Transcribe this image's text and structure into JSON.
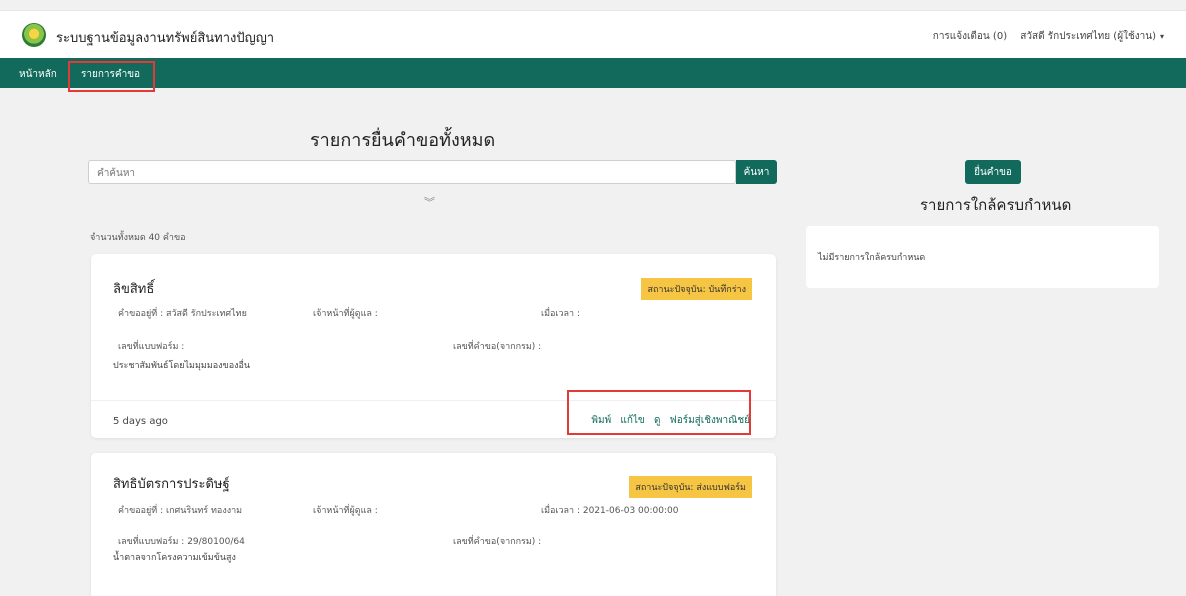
{
  "header": {
    "title": "ระบบฐานข้อมูลงานทรัพย์สินทางปัญญา",
    "notifications": "การแจ้งเตือน (0)",
    "user": "สวัสดี รักประเทศไทย (ผู้ใช้งาน)"
  },
  "nav": {
    "items": [
      "หน้าหลัก",
      "รายการคำขอ"
    ]
  },
  "main": {
    "title": "รายการยื่นคำขอทั้งหมด",
    "search_placeholder": "คำค้นหา",
    "search_button": "ค้นหา",
    "count": "จำนวนทั้งหมด 40 คำขอ"
  },
  "cards": [
    {
      "title": "ลิขสิทธิ์",
      "status": "สถานะปัจจุบัน: บันทึกร่าง",
      "requester": "คำขออยู่ที่ : สวัสดี รักประเทศไทย",
      "officer": "เจ้าหน้าที่ผู้ดูแล :",
      "time": "เมื่อเวลา :",
      "form_no": "เลขที่แบบฟอร์ม :",
      "request_no": "เลขที่คำขอ(จากกรม) :",
      "description": "ประชาสัมพันธ์โดยไมมุมมองของอื่น",
      "ago": "5 days ago",
      "actions": [
        "พิมพ์",
        "แก้ไข",
        "ดู",
        "ฟอร์มสู่เชิงพาณิชย์"
      ]
    },
    {
      "title": "สิทธิบัตรการประดิษฐ์",
      "status": "สถานะปัจจุบัน: ส่งแบบฟอร์ม",
      "requester": "คำขออยู่ที่ : เกศนรินทร์ ทองงาม",
      "officer": "เจ้าหน้าที่ผู้ดูแล :",
      "time": "เมื่อเวลา : 2021-06-03 00:00:00",
      "form_no": "เลขที่แบบฟอร์ม : 29/80100/64",
      "request_no": "เลขที่คำขอ(จากกรม) :",
      "description": "น้ำตาลจากโครงความเข้มข้นสูง"
    }
  ],
  "sidebar": {
    "submit_button": "ยื่นคำขอ",
    "title": "รายการใกล้ครบกำหนด",
    "empty": "ไม่มีรายการใกล้ครบกำหนด"
  },
  "colors": {
    "brand": "#116a5c",
    "badge": "#f6c543",
    "highlight": "#e53935"
  }
}
